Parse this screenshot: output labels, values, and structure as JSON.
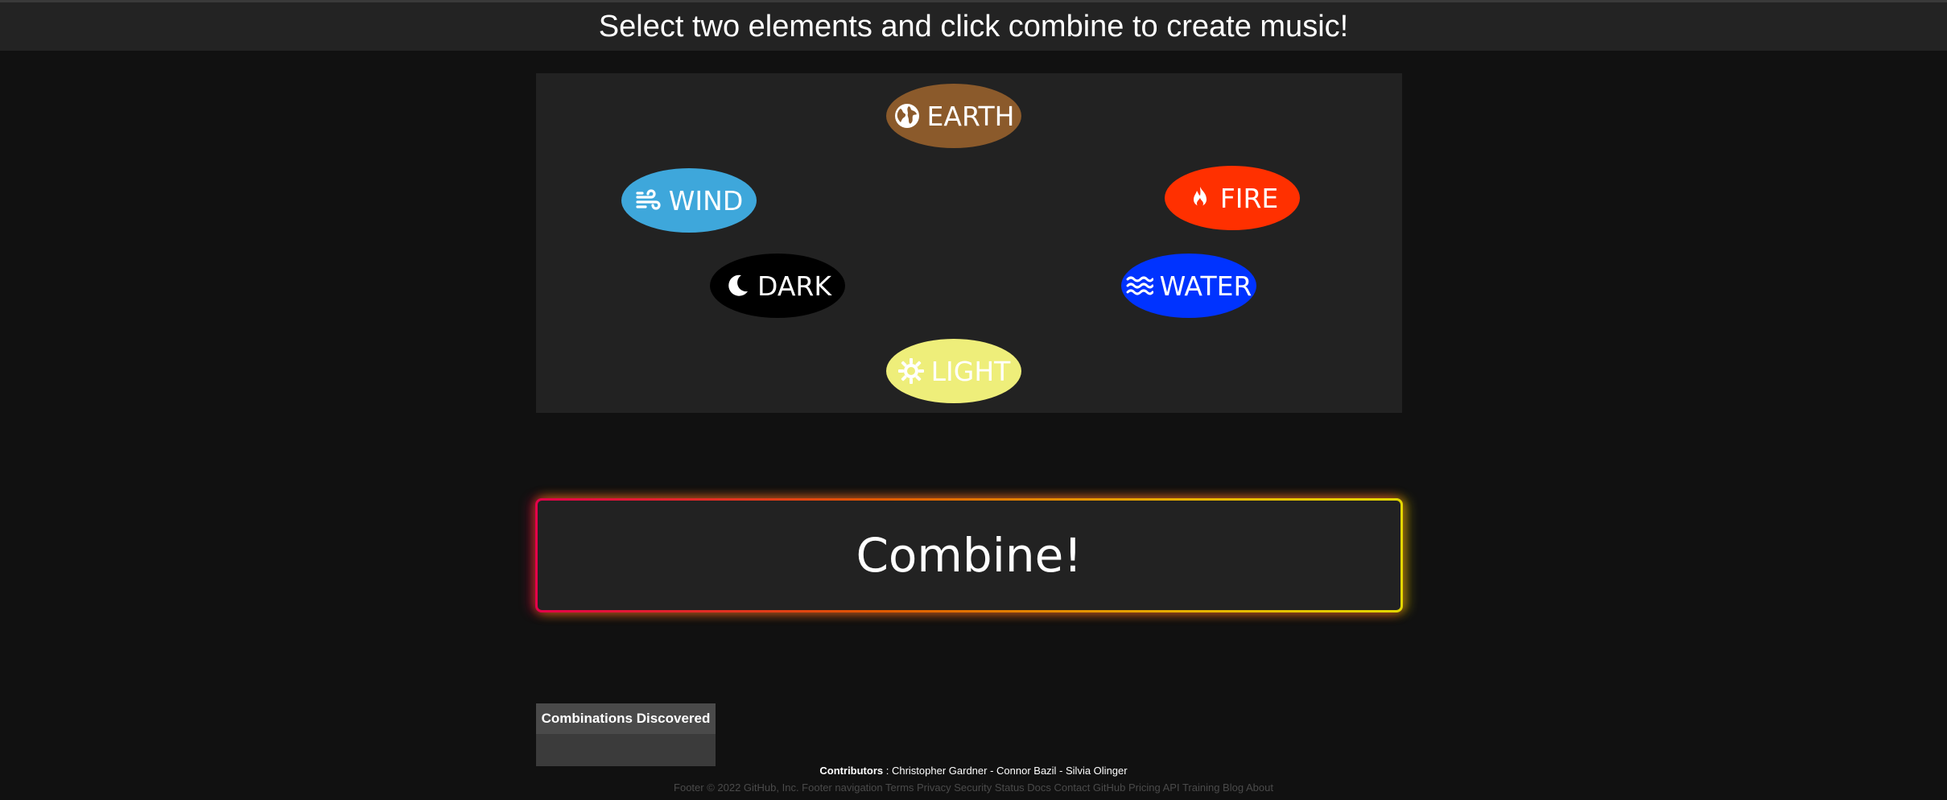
{
  "header": {
    "title": "Select two elements and click combine to create music!"
  },
  "elements": [
    {
      "id": "earth",
      "label": "EARTH",
      "icon": "globe-icon",
      "color": "#8b5a2b"
    },
    {
      "id": "wind",
      "label": "WIND",
      "icon": "wind-icon",
      "color": "#3ea7db"
    },
    {
      "id": "fire",
      "label": "FIRE",
      "icon": "fire-icon",
      "color": "#ff3000"
    },
    {
      "id": "dark",
      "label": "DARK",
      "icon": "moon-icon",
      "color": "#000000"
    },
    {
      "id": "water",
      "label": "WATER",
      "icon": "water-icon",
      "color": "#0033ff"
    },
    {
      "id": "light",
      "label": "LIGHT",
      "icon": "sun-icon",
      "color": "#eeee7a"
    }
  ],
  "combine": {
    "label": "Combine!",
    "glow_colors": [
      "#e4004a",
      "#e3d700"
    ]
  },
  "combinations": {
    "title": "Combinations Discovered",
    "items": []
  },
  "contributors": {
    "label": "Contributors",
    "separator": " : ",
    "names": "Christopher Gardner - Connor Bazil - Silvia Olinger"
  },
  "footer": {
    "text": "Footer © 2022 GitHub, Inc. Footer navigation Terms Privacy Security Status Docs Contact GitHub Pricing API Training Blog About"
  }
}
